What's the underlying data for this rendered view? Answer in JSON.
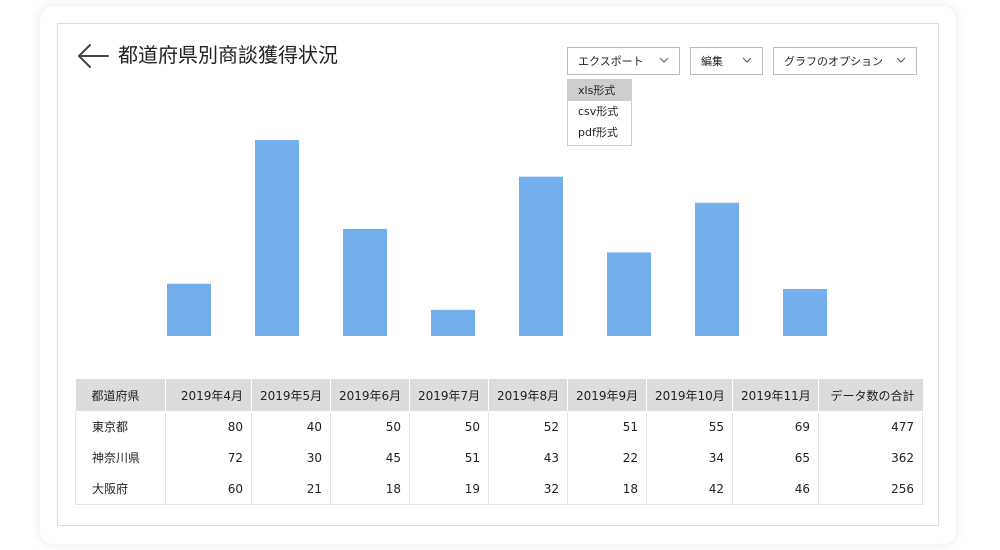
{
  "page": {
    "title": "都道府県別商談獲得状況"
  },
  "toolbar": {
    "export_label": "エクスポート",
    "edit_label": "編集",
    "graph_options_label": "グラフのオプション"
  },
  "export_menu": {
    "items": [
      "xls形式",
      "csv形式",
      "pdf形式"
    ],
    "selected": "xls形式"
  },
  "icons": {
    "back": "arrow-left-icon",
    "dropdown": "chevron-down-icon"
  },
  "colors": {
    "bar": "#73aeed",
    "header_bg": "#dcdcdc",
    "menu_selected": "#cdcdcd"
  },
  "chart_data": {
    "type": "bar",
    "categories": [
      "",
      "",
      "",
      "",
      "",
      "",
      "",
      ""
    ],
    "values": [
      20,
      75,
      41,
      10,
      61,
      32,
      51,
      18
    ],
    "ylim": [
      0,
      80
    ],
    "grid": false,
    "title": "",
    "xlabel": "",
    "ylabel": ""
  },
  "table": {
    "headers": [
      "都道府県",
      "2019年4月",
      "2019年5月",
      "2019年6月",
      "2019年7月",
      "2019年8月",
      "2019年9月",
      "2019年10月",
      "2019年11月",
      "データ数の合計"
    ],
    "rows": [
      [
        "東京都",
        "80",
        "40",
        "50",
        "50",
        "52",
        "51",
        "55",
        "69",
        "477"
      ],
      [
        "神奈川県",
        "72",
        "30",
        "45",
        "51",
        "43",
        "22",
        "34",
        "65",
        "362"
      ],
      [
        "大阪府",
        "60",
        "21",
        "18",
        "19",
        "32",
        "18",
        "42",
        "46",
        "256"
      ]
    ]
  }
}
